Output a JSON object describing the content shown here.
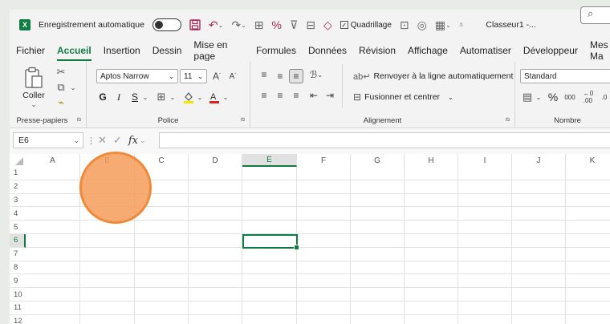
{
  "titlebar": {
    "app_icon": "X",
    "autosave_label": "Enregistrement automatique",
    "autosave_state": "off",
    "gridlines_label": "Quadrillage",
    "gridlines_checked": true,
    "document_name": "Classeur1 -...",
    "search_icon": "search-icon"
  },
  "menu": {
    "items": [
      "Fichier",
      "Accueil",
      "Insertion",
      "Dessin",
      "Mise en page",
      "Formules",
      "Données",
      "Révision",
      "Affichage",
      "Automatiser",
      "Développeur",
      "Mes Ma"
    ],
    "active": "Accueil"
  },
  "ribbon": {
    "clipboard": {
      "paste_label": "Coller",
      "group_label": "Presse-papiers"
    },
    "font": {
      "font_name": "Aptos Narrow",
      "font_size": "11",
      "bold": "G",
      "italic": "I",
      "underline": "S",
      "group_label": "Police"
    },
    "alignment": {
      "wrap_label": "Renvoyer à la ligne automatiquement",
      "merge_label": "Fusionner et centrer",
      "group_label": "Alignement"
    },
    "number": {
      "format": "Standard",
      "percent": "%",
      "thousands": "000",
      "group_label": "Nombre"
    }
  },
  "formula_bar": {
    "name_box": "E6",
    "fx": "fx",
    "value": ""
  },
  "grid": {
    "columns": [
      "A",
      "B",
      "C",
      "D",
      "E",
      "F",
      "G",
      "H",
      "I",
      "J",
      "K"
    ],
    "rows": [
      "1",
      "2",
      "3",
      "4",
      "5",
      "6",
      "7",
      "8",
      "9",
      "10",
      "11",
      "12"
    ],
    "selected_column": "E",
    "selected_row": "6"
  },
  "colors": {
    "accent": "#107c41",
    "cursor_marker": "#f49c59"
  }
}
